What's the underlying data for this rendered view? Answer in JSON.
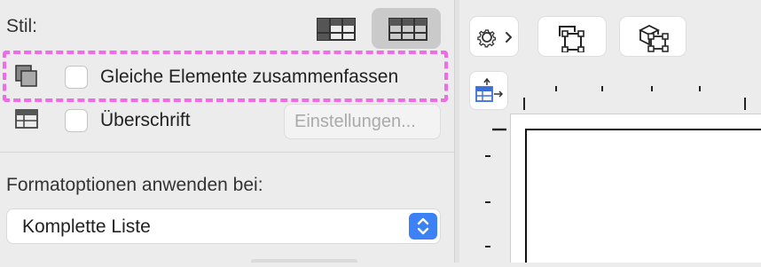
{
  "left_panel": {
    "style_label": "Stil:",
    "group_same_elements_label": "Gleiche Elemente zusammenfassen",
    "group_same_elements_checked": false,
    "heading_label": "Überschrift",
    "heading_checked": false,
    "settings_button_label": "Einstellungen...",
    "format_options_label": "Formatoptionen anwenden bei:",
    "scope_select_value": "Komplette Liste"
  },
  "icons": {
    "style_table_a": "table-grid-icon",
    "style_table_b": "table-grid-alt-icon",
    "group_elements": "stacked-squares-icon",
    "heading": "table-header-icon",
    "settings": "gear-chevron-icon",
    "frame": "frame-select-icon",
    "three_d": "3d-box-icon",
    "columns": "column-add-icon",
    "select_chevron": "updown-chevron-icon"
  },
  "colors": {
    "highlight": "#f06ce6",
    "accent": "#3c82f6",
    "panel_bg": "#ececec"
  }
}
